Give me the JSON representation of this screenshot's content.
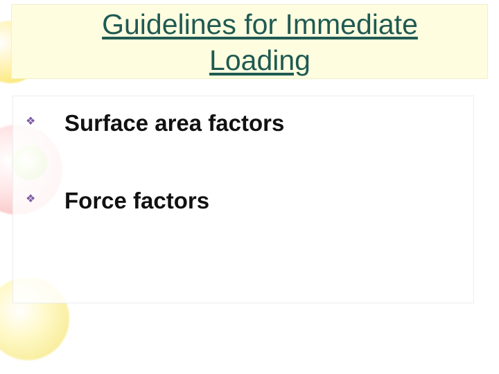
{
  "title": "Guidelines for Immediate Loading",
  "bullets": [
    {
      "text": "Surface area  factors"
    },
    {
      "text": "Force factors"
    }
  ]
}
